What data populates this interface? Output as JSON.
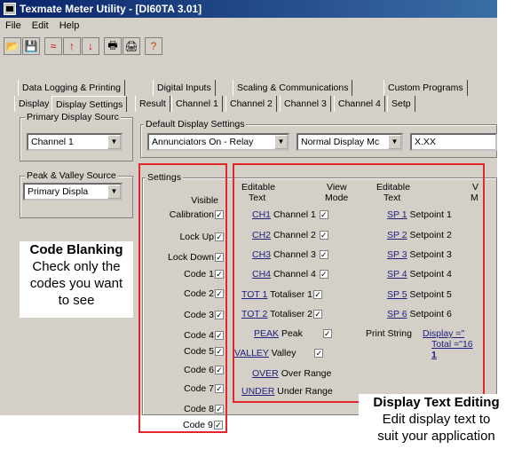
{
  "window": {
    "title": "Texmate Meter Utility   - [DI60TA  3.01]"
  },
  "menu": [
    "File",
    "Edit",
    "Help"
  ],
  "tabs_row1": [
    "Data Logging & Printing",
    "Digital Inputs",
    "Scaling & Communications",
    "Custom Programs"
  ],
  "tabs_row2": [
    "Display",
    "Display Settings",
    "Result",
    "Channel 1",
    "Channel 2",
    "Channel 3",
    "Channel 4",
    "Setp"
  ],
  "primary_display": {
    "label": "Primary Display Sourc",
    "value": "Channel 1"
  },
  "peak_valley": {
    "label": "Peak & Valley Source",
    "value": "Primary Displa"
  },
  "default_display": {
    "label": "Default Display Settings",
    "annunciators": "Annunciators On - Relay",
    "mode": "Normal Display Mc",
    "format": "X.XX"
  },
  "settings": {
    "label": "Settings",
    "visible_header": "Visible",
    "items": [
      "Calibration",
      "Lock Up",
      "Lock Down",
      "Code 1",
      "Code 2",
      "Code 3",
      "Code 4",
      "Code 5",
      "Code 6",
      "Code 7",
      "Code 8",
      "Code 9"
    ],
    "check": "✓"
  },
  "display_text": {
    "header_editable_1": "Editable",
    "header_text_1": "Text",
    "header_view": "View",
    "header_mode": "Mode",
    "header_editable_2": "Editable",
    "header_text_2": "Text",
    "header_v": "V",
    "header_m": "M",
    "left": [
      {
        "code": "CH1",
        "name": "Channel 1",
        "check": true
      },
      {
        "code": "CH2",
        "name": "Channel 2",
        "check": true
      },
      {
        "code": "CH3",
        "name": "Channel 3",
        "check": true
      },
      {
        "code": "CH4",
        "name": "Channel 4",
        "check": true
      },
      {
        "code": "TOT 1",
        "name": "Totaliser 1",
        "check": true
      },
      {
        "code": "TOT 2",
        "name": "Totaliser 2",
        "check": true
      },
      {
        "code": "PEAK",
        "name": "Peak",
        "check": true
      },
      {
        "code": "VALLEY",
        "name": "Valley",
        "check": true
      },
      {
        "code": "OVER",
        "name": "Over Range",
        "check": false
      },
      {
        "code": "UNDER",
        "name": "Under Range",
        "check": false
      }
    ],
    "right": [
      {
        "code": "SP 1",
        "name": "Setpoint 1"
      },
      {
        "code": "SP 2",
        "name": "Setpoint 2"
      },
      {
        "code": "SP 3",
        "name": "Setpoint 3"
      },
      {
        "code": "SP 4",
        "name": "Setpoint 4"
      },
      {
        "code": "SP 5",
        "name": "Setpoint 5"
      },
      {
        "code": "SP 6",
        "name": "Setpoint 6"
      }
    ],
    "print_label": "Print String",
    "print_line1": "Display =\"",
    "print_line2": "Total =\"16",
    "print_line3": "1"
  },
  "callouts": {
    "code_blanking_title": "Code Blanking",
    "code_blanking_l1": "Check only the",
    "code_blanking_l2": "codes you want",
    "code_blanking_l3": "to see",
    "display_text_title": "Display Text Editing",
    "display_text_l1": "Edit display text to",
    "display_text_l2": "suit your application"
  },
  "colors": {
    "highlight": "#e4262d",
    "titlebar": "#0a246a",
    "face": "#d4d0c8"
  }
}
